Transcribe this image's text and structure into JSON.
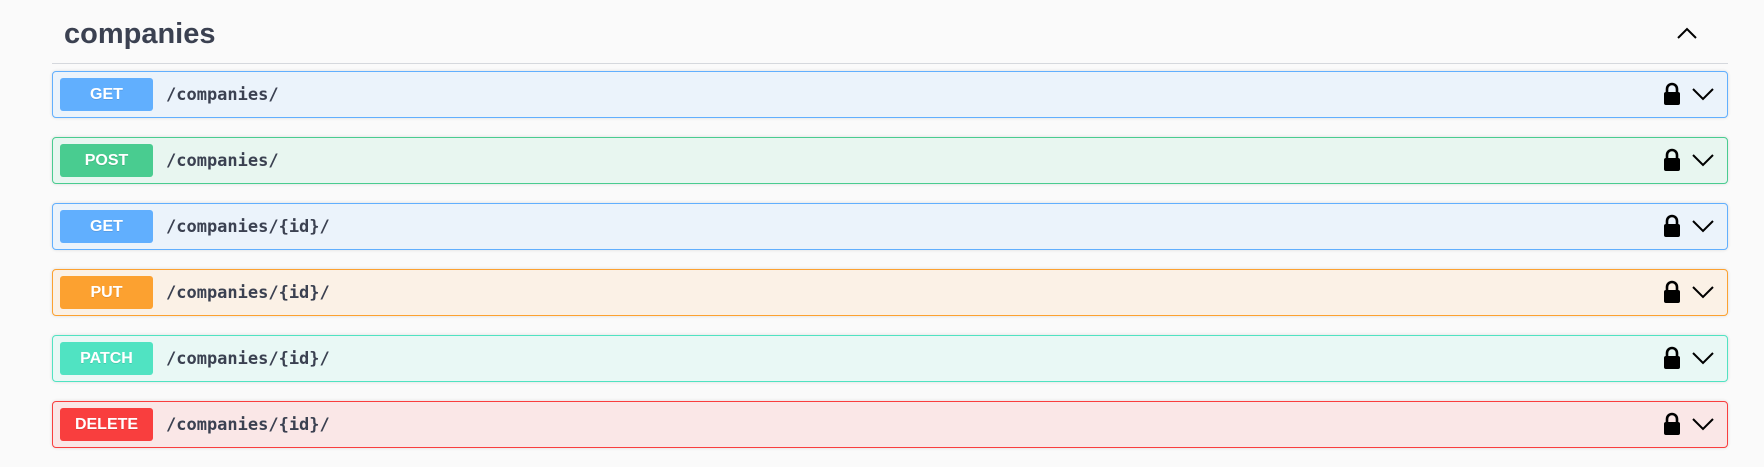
{
  "section": {
    "title": "companies"
  },
  "operations": [
    {
      "method": "GET",
      "path": "/companies/",
      "color": "#61affe"
    },
    {
      "method": "POST",
      "path": "/companies/",
      "color": "#49cc90"
    },
    {
      "method": "GET",
      "path": "/companies/{id}/",
      "color": "#61affe"
    },
    {
      "method": "PUT",
      "path": "/companies/{id}/",
      "color": "#fca130"
    },
    {
      "method": "PATCH",
      "path": "/companies/{id}/",
      "color": "#50e3c2"
    },
    {
      "method": "DELETE",
      "path": "/companies/{id}/",
      "color": "#f93e3e"
    }
  ],
  "icons": {
    "collapse": "chevron-up-icon",
    "lock": "lock-icon",
    "expand": "chevron-down-icon"
  }
}
